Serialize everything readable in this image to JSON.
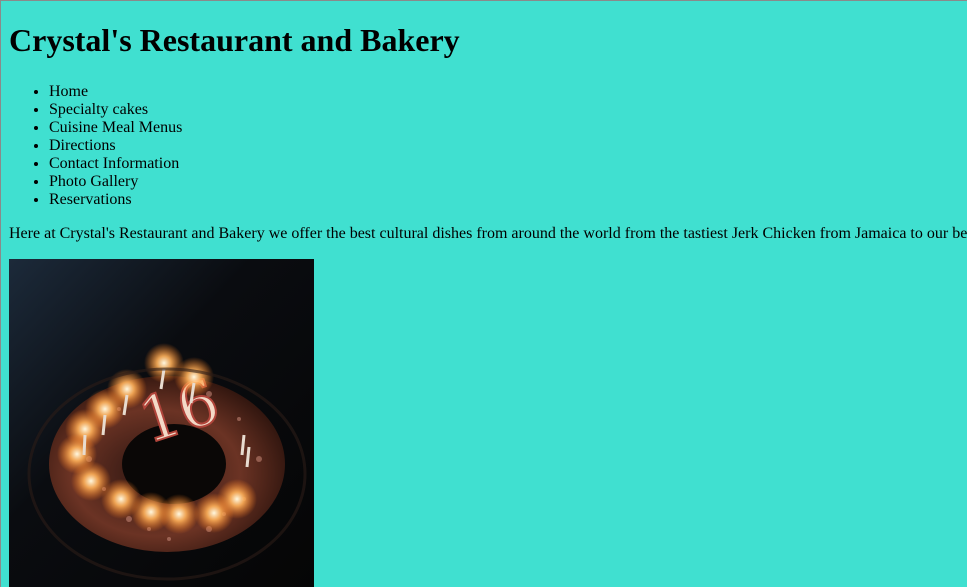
{
  "header": {
    "title": "Crystal's Restaurant and Bakery"
  },
  "nav": {
    "items": [
      {
        "label": "Home"
      },
      {
        "label": "Specialty cakes"
      },
      {
        "label": "Cuisine Meal Menus"
      },
      {
        "label": "Directions"
      },
      {
        "label": "Contact Information"
      },
      {
        "label": "Photo Gallery"
      },
      {
        "label": "Reservations"
      }
    ]
  },
  "main": {
    "intro": "Here at Crystal's Restaurant and Bakery we offer the best cultural dishes from around the world from the tastiest Jerk Chicken from Jamaica to our be",
    "photo_alt": "cake-with-16-candles-icon"
  },
  "colors": {
    "background": "#40E0D0",
    "text": "#000000"
  }
}
